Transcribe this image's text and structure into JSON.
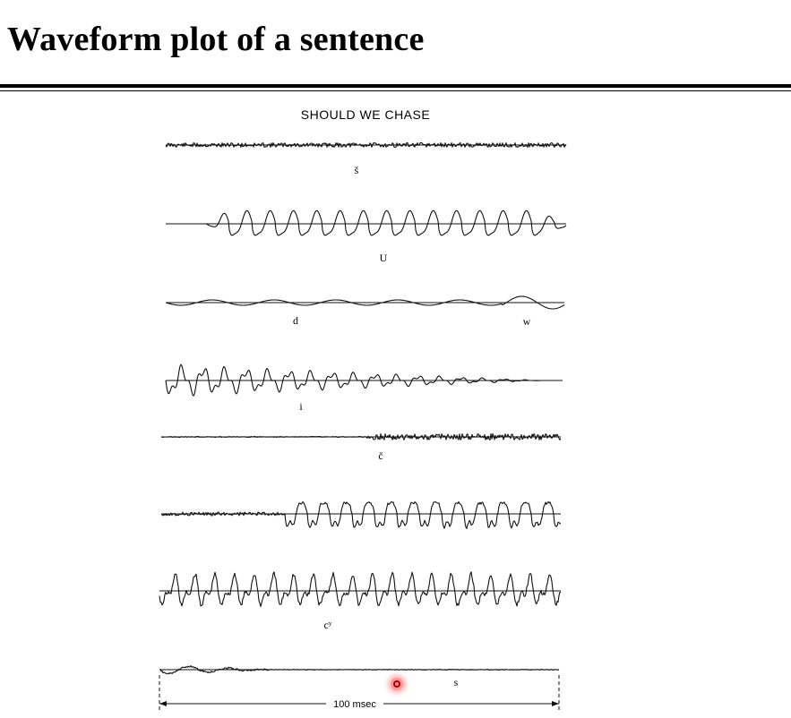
{
  "header": {
    "title": "Waveform plot of a sentence"
  },
  "figure": {
    "title": "SHOULD WE CHASE",
    "rows": [
      {
        "labels": [
          "š"
        ]
      },
      {
        "labels": [
          "U"
        ]
      },
      {
        "labels": [
          "d",
          "w"
        ]
      },
      {
        "labels": [
          "i"
        ]
      },
      {
        "labels": [
          "č"
        ]
      },
      {
        "labels": []
      },
      {
        "labels": [
          "cʸ"
        ]
      },
      {
        "labels": [
          "s"
        ]
      }
    ],
    "scale_label": "100 msec"
  }
}
